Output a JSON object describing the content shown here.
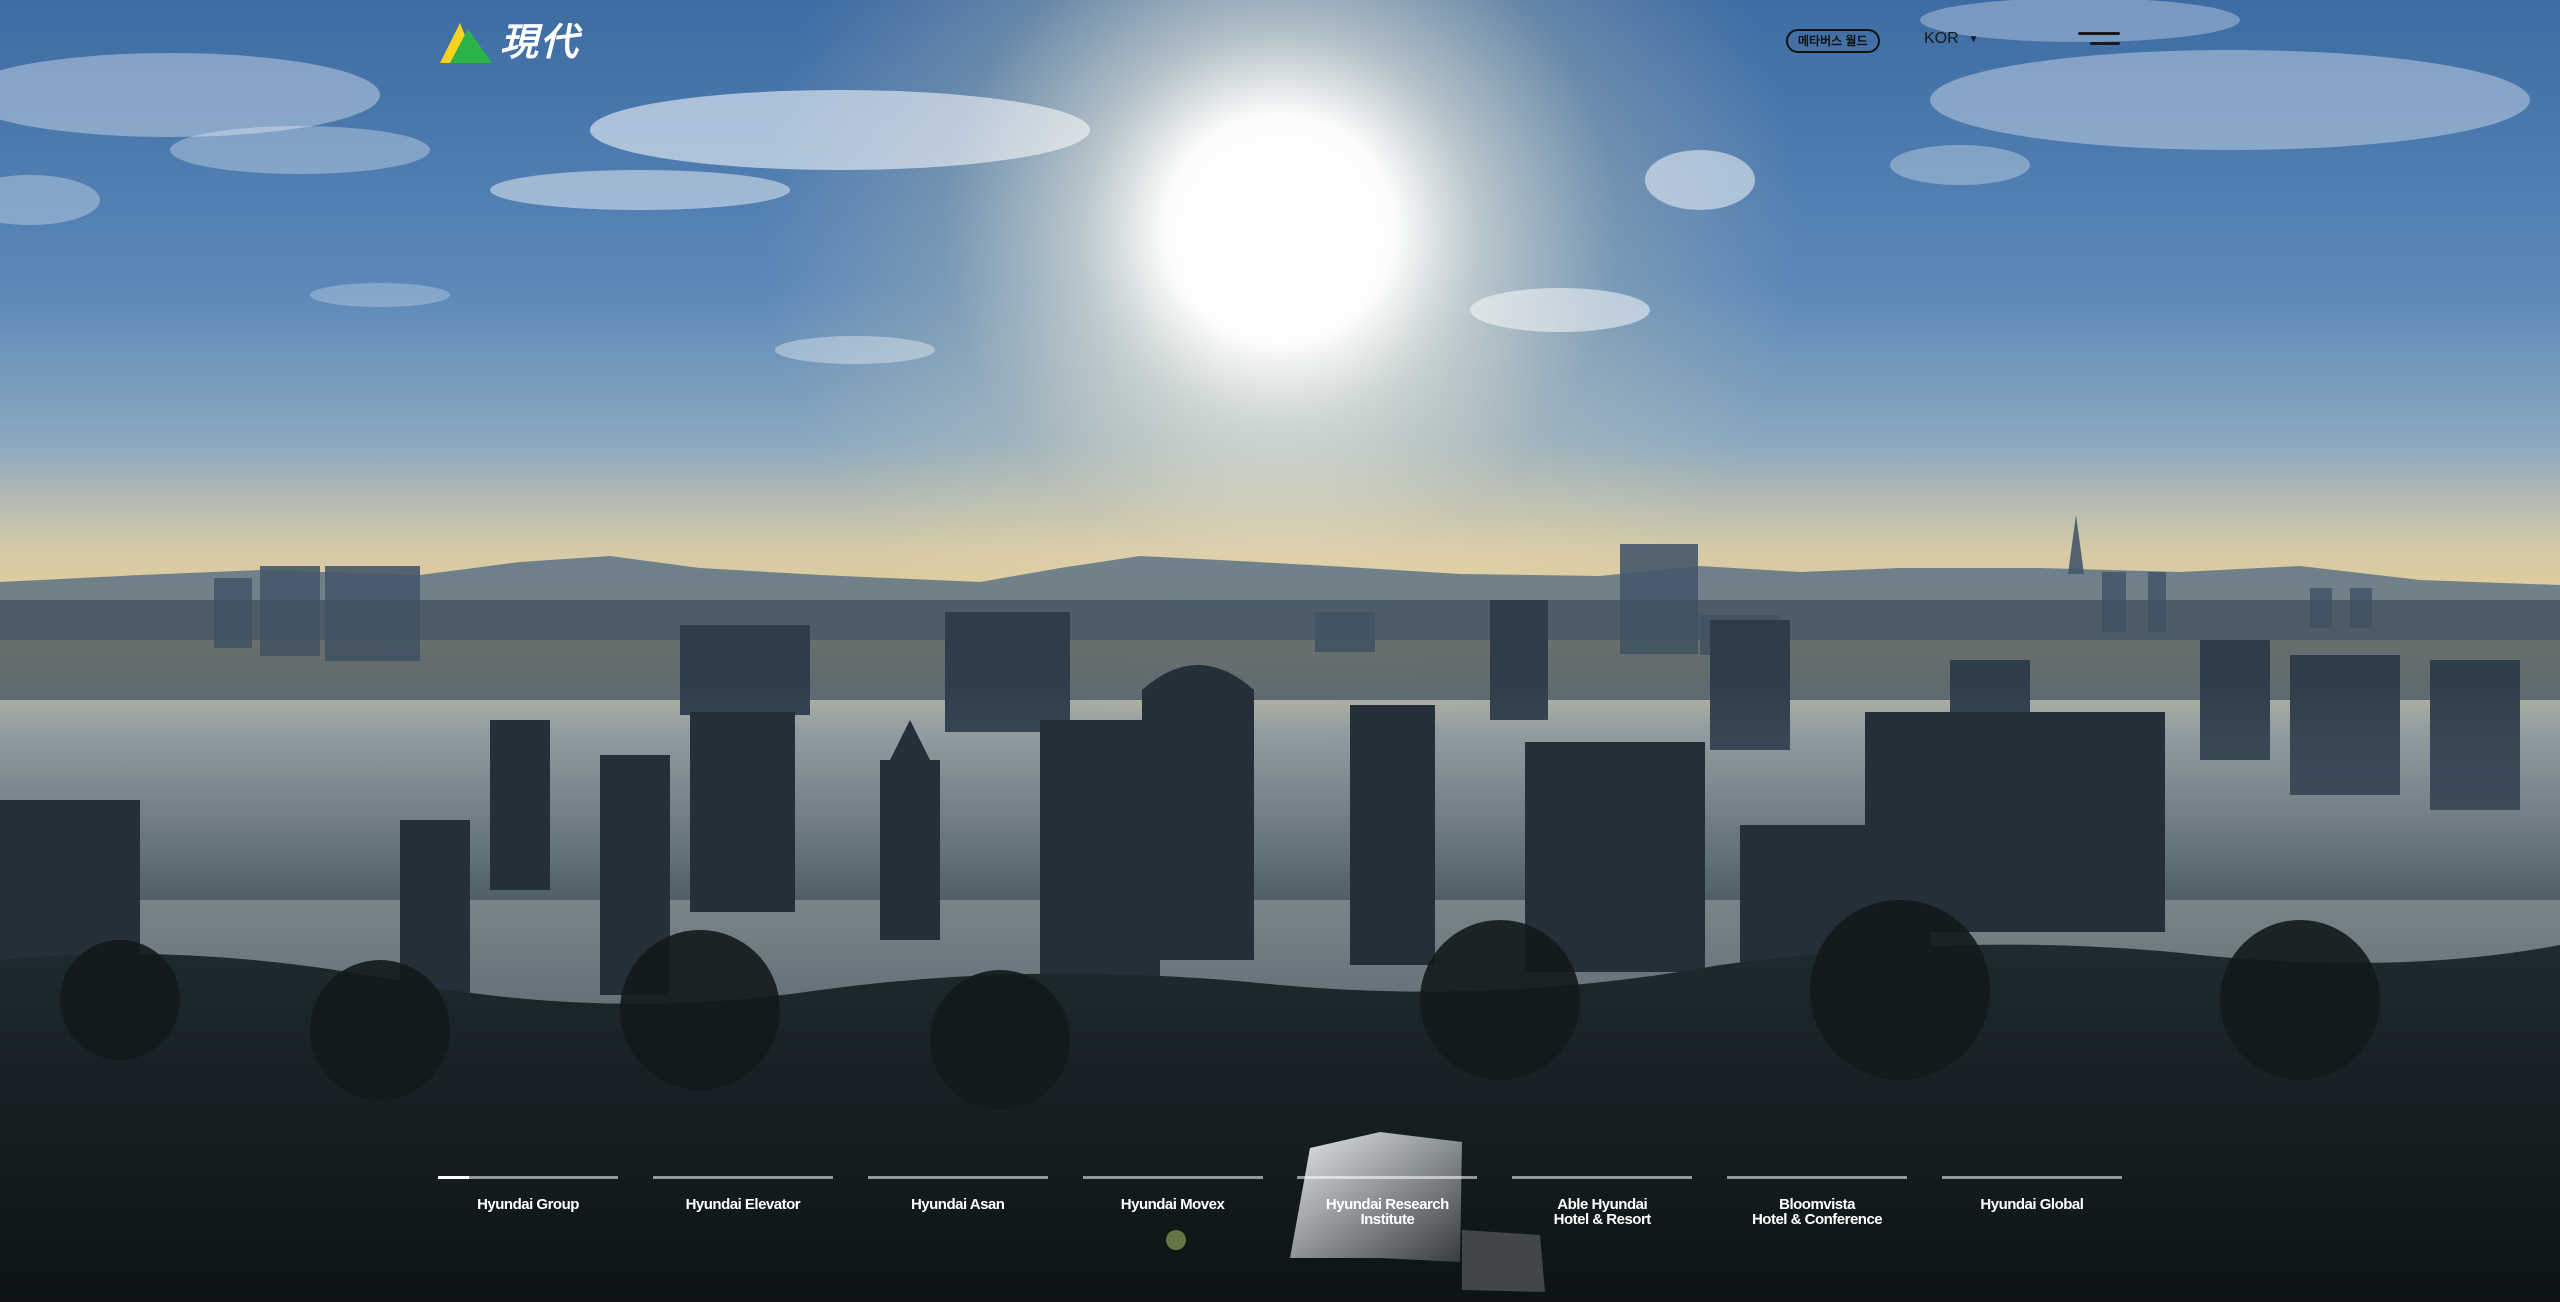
{
  "header": {
    "logo": {
      "text": "現代",
      "mark_colors": [
        "#f7d21e",
        "#2bb34a"
      ]
    },
    "metaverse_label": "메타버스 월드",
    "language": {
      "selected": "KOR",
      "caret": "▼"
    },
    "menu_icon": "hamburger-icon"
  },
  "hero": {
    "scene": "city-skyline-sunrise"
  },
  "affiliates": {
    "active_index": 0,
    "active_progress": 0.17,
    "items": [
      {
        "label": "Hyundai Group"
      },
      {
        "label": "Hyundai Elevator"
      },
      {
        "label": "Hyundai Asan"
      },
      {
        "label": "Hyundai Movex"
      },
      {
        "label": "Hyundai Research Institute"
      },
      {
        "label": "Able Hyundai\nHotel & Resort"
      },
      {
        "label": "Bloomvista\nHotel & Conference"
      },
      {
        "label": "Hyundai Global"
      }
    ]
  },
  "colors": {
    "sky_top": "#3f6ea5",
    "sky_horizon": "#f2d9a2",
    "sun": "#ffffff",
    "city": "#2c3a46",
    "foreground": "#141b1c"
  }
}
